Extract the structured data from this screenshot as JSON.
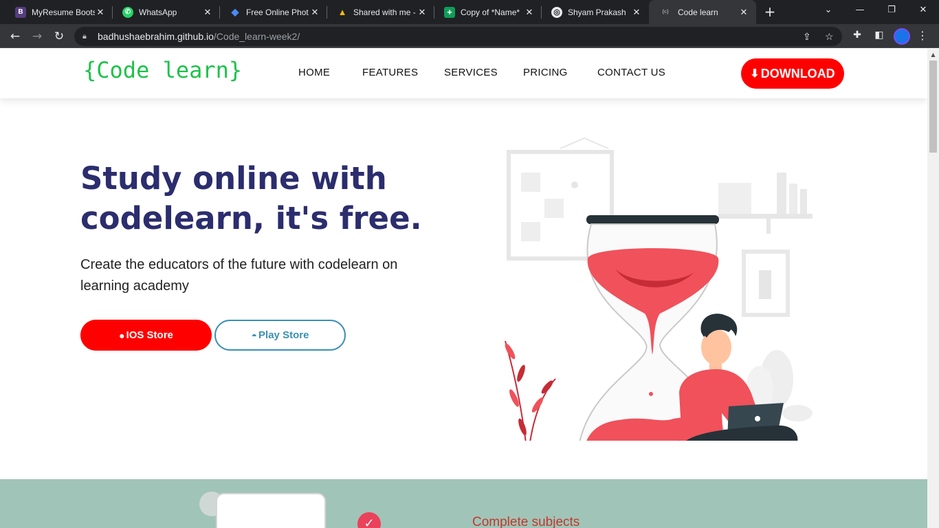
{
  "browser": {
    "tabs": [
      {
        "title": "MyResume Boots",
        "favicon": "B",
        "favicon_color": "#563d7c"
      },
      {
        "title": "WhatsApp",
        "favicon": "✆",
        "favicon_color": "#25d366"
      },
      {
        "title": "Free Online Phot",
        "favicon": "◆",
        "favicon_color": "#4a8af4"
      },
      {
        "title": "Shared with me -",
        "favicon": "▲",
        "favicon_color": "#fbbc04"
      },
      {
        "title": "Copy of *Name*",
        "favicon": "+",
        "favicon_color": "#0f9d58"
      },
      {
        "title": "Shyam Prakash",
        "favicon": "◎",
        "favicon_color": "#24292e"
      },
      {
        "title": "Code learn",
        "favicon": "{c}",
        "favicon_color": "#35363a"
      }
    ],
    "active_tab_index": 6,
    "url_host": "badhushaebrahim.github.io",
    "url_path": "/Code_learn-week2/"
  },
  "site": {
    "logo": "{Code learn}",
    "nav": [
      "HOME",
      "FEATURES",
      "SERVICES",
      "PRICING",
      "CONTACT US"
    ],
    "download_label": "DOWNLOAD",
    "hero_title_line1": "Study online with",
    "hero_title_line2": "codelearn, it's free.",
    "hero_subtitle": "Create the educators of the future with codelearn on learning academy",
    "ios_label": "IOS Store",
    "play_label": "Play Store",
    "features_heading": "Complete subjects"
  },
  "colors": {
    "logo": "#1ec24a",
    "title": "#2b2d6e",
    "primary_red": "#ff0000",
    "play_blue": "#3a8fb7",
    "features_bg": "#a1c4b8"
  }
}
